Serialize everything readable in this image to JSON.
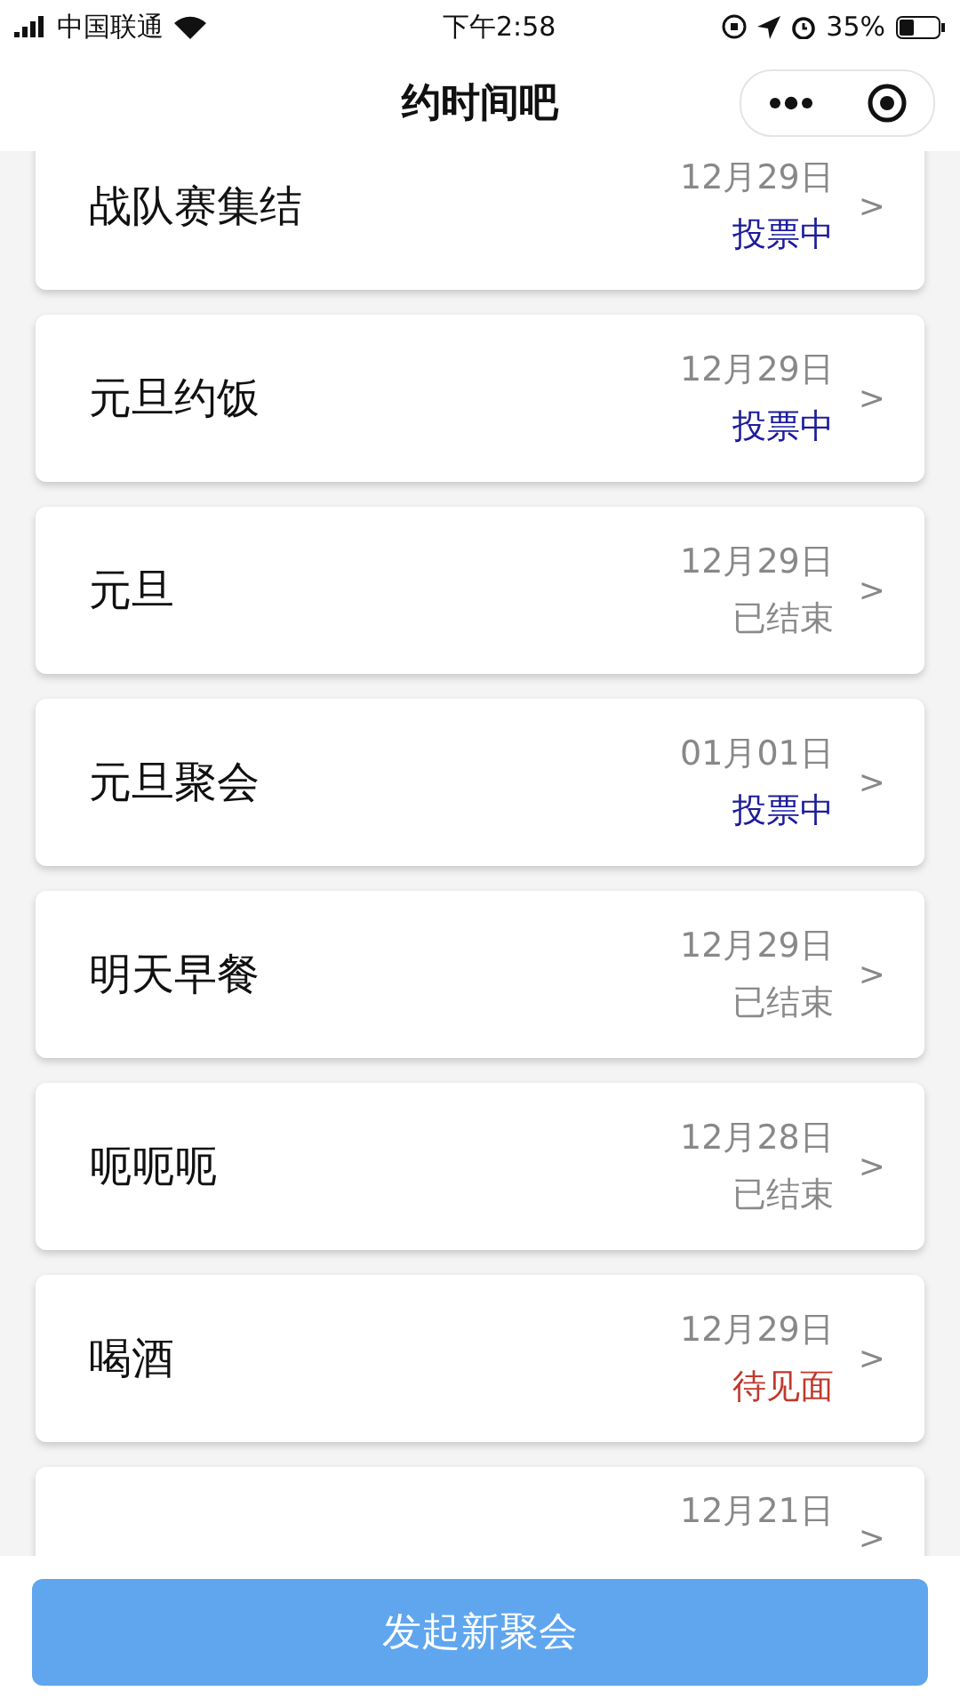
{
  "status_bar": {
    "carrier": "中国联通",
    "time": "下午2:58",
    "battery": "35%"
  },
  "nav": {
    "title": "约时间吧"
  },
  "events": [
    {
      "title": "战队赛集结",
      "date": "12月29日",
      "status": "投票中",
      "kind": "voting"
    },
    {
      "title": "元旦约饭",
      "date": "12月29日",
      "status": "投票中",
      "kind": "voting"
    },
    {
      "title": "元旦",
      "date": "12月29日",
      "status": "已结束",
      "kind": "ended"
    },
    {
      "title": "元旦聚会",
      "date": "01月01日",
      "status": "投票中",
      "kind": "voting"
    },
    {
      "title": "明天早餐",
      "date": "12月29日",
      "status": "已结束",
      "kind": "ended"
    },
    {
      "title": "呃呃呃",
      "date": "12月28日",
      "status": "已结束",
      "kind": "ended"
    },
    {
      "title": "喝酒",
      "date": "12月29日",
      "status": "待见面",
      "kind": "waiting"
    },
    {
      "date": "12月21日",
      "kind": "partial"
    }
  ],
  "chevron": ">",
  "new_button": "发起新聚会"
}
